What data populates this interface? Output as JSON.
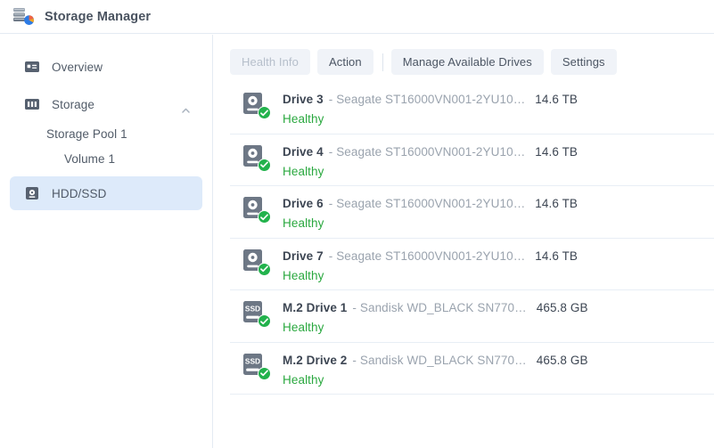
{
  "window": {
    "title": "Storage Manager",
    "app_icon": "storage-manager-icon"
  },
  "sidebar": {
    "items": [
      {
        "label": "Overview",
        "icon": "overview-icon",
        "type": "item",
        "selected": false
      },
      {
        "label": "Storage",
        "icon": "storage-icon",
        "type": "item",
        "selected": false,
        "expanded": true,
        "chevron": "chevron-up-icon"
      },
      {
        "label": "Storage Pool 1",
        "type": "sub",
        "selected": false
      },
      {
        "label": "Volume 1",
        "type": "sub2",
        "selected": false
      },
      {
        "label": "HDD/SSD",
        "icon": "hdd-ssd-icon",
        "type": "item",
        "selected": true
      }
    ]
  },
  "toolbar": {
    "buttons": [
      {
        "label": "Health Info",
        "disabled": true
      },
      {
        "label": "Action",
        "disabled": false
      },
      {
        "label": "Manage Available Drives",
        "disabled": false
      },
      {
        "label": "Settings",
        "disabled": false
      }
    ],
    "separator_after_index": 1
  },
  "drives": [
    {
      "name": "Drive 3",
      "separator": "-",
      "model": "Seagate ST16000VN001-2YU10…",
      "size": "14.6 TB",
      "status": "Healthy",
      "icon": "hdd-icon",
      "badge": "check-circle-icon"
    },
    {
      "name": "Drive 4",
      "separator": "-",
      "model": "Seagate ST16000VN001-2YU10…",
      "size": "14.6 TB",
      "status": "Healthy",
      "icon": "hdd-icon",
      "badge": "check-circle-icon"
    },
    {
      "name": "Drive 6",
      "separator": "-",
      "model": "Seagate ST16000VN001-2YU10…",
      "size": "14.6 TB",
      "status": "Healthy",
      "icon": "hdd-icon",
      "badge": "check-circle-icon"
    },
    {
      "name": "Drive 7",
      "separator": "-",
      "model": "Seagate ST16000VN001-2YU10…",
      "size": "14.6 TB",
      "status": "Healthy",
      "icon": "hdd-icon",
      "badge": "check-circle-icon"
    },
    {
      "name": "M.2 Drive 1",
      "separator": "-",
      "model": "Sandisk WD_BLACK SN770…",
      "size": "465.8 GB",
      "status": "Healthy",
      "icon": "ssd-icon",
      "badge": "check-circle-icon",
      "icon_label": "SSD"
    },
    {
      "name": "M.2 Drive 2",
      "separator": "-",
      "model": "Sandisk WD_BLACK SN770…",
      "size": "465.8 GB",
      "status": "Healthy",
      "icon": "ssd-icon",
      "badge": "check-circle-icon",
      "icon_label": "SSD"
    }
  ],
  "colors": {
    "accent_selected": "#ddeafa",
    "status_healthy": "#2aa83f",
    "badge_green": "#22b24c",
    "text_primary": "#3d4653",
    "text_muted": "#9aa3ae",
    "button_bg": "#f0f3f8",
    "border": "#e4ebf2"
  }
}
